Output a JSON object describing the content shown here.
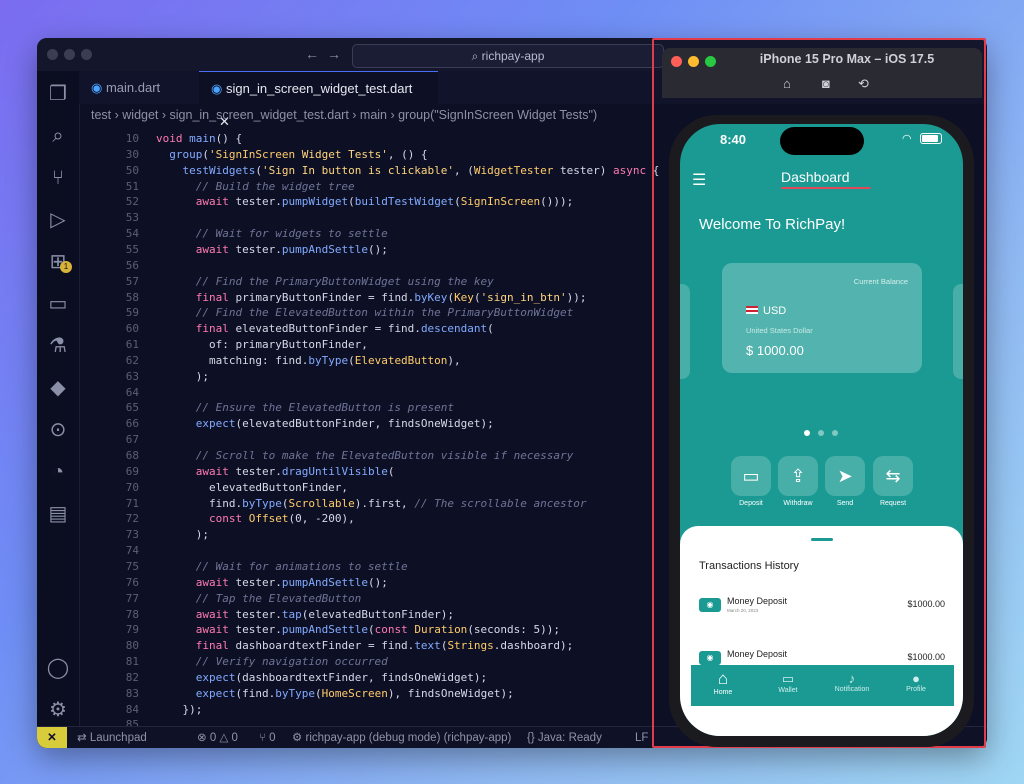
{
  "vscode": {
    "command_center": "richpay-app",
    "tabs": [
      {
        "label": "main.dart",
        "active": false
      },
      {
        "label": "sign_in_screen_widget_test.dart",
        "active": true,
        "close": "✕"
      }
    ],
    "breadcrumb": [
      "test",
      "widget",
      "sign_in_screen_widget_test.dart",
      "main",
      "group(\"SignInScreen Widget Tests\")"
    ],
    "sticky_lines": [
      {
        "n": "10",
        "code": "void main() {"
      },
      {
        "n": "30",
        "code": "  group('SignInScreen Widget Tests', () {"
      },
      {
        "n": "50",
        "code": "    testWidgets('Sign In button is clickable', (WidgetTester tester) async {"
      }
    ],
    "code_lines": [
      {
        "n": "51",
        "code": "      // Build the widget tree"
      },
      {
        "n": "52",
        "code": "      await tester.pumpWidget(buildTestWidget(SignInScreen()));"
      },
      {
        "n": "53",
        "code": ""
      },
      {
        "n": "54",
        "code": "      // Wait for widgets to settle"
      },
      {
        "n": "55",
        "code": "      await tester.pumpAndSettle();"
      },
      {
        "n": "56",
        "code": ""
      },
      {
        "n": "57",
        "code": "      // Find the PrimaryButtonWidget using the key"
      },
      {
        "n": "58",
        "code": "      final primaryButtonFinder = find.byKey(Key('sign_in_btn'));"
      },
      {
        "n": "59",
        "code": "      // Find the ElevatedButton within the PrimaryButtonWidget"
      },
      {
        "n": "60",
        "code": "      final elevatedButtonFinder = find.descendant("
      },
      {
        "n": "61",
        "code": "        of: primaryButtonFinder,"
      },
      {
        "n": "62",
        "code": "        matching: find.byType(ElevatedButton),"
      },
      {
        "n": "63",
        "code": "      );"
      },
      {
        "n": "64",
        "code": ""
      },
      {
        "n": "65",
        "code": "      // Ensure the ElevatedButton is present"
      },
      {
        "n": "66",
        "code": "      expect(elevatedButtonFinder, findsOneWidget);"
      },
      {
        "n": "67",
        "code": ""
      },
      {
        "n": "68",
        "code": "      // Scroll to make the ElevatedButton visible if necessary"
      },
      {
        "n": "69",
        "code": "      await tester.dragUntilVisible("
      },
      {
        "n": "70",
        "code": "        elevatedButtonFinder,"
      },
      {
        "n": "71",
        "code": "        find.byType(Scrollable).first, // The scrollable ancestor"
      },
      {
        "n": "72",
        "code": "        const Offset(0, -200),"
      },
      {
        "n": "73",
        "code": "      );"
      },
      {
        "n": "74",
        "code": ""
      },
      {
        "n": "75",
        "code": "      // Wait for animations to settle"
      },
      {
        "n": "76",
        "code": "      await tester.pumpAndSettle();"
      },
      {
        "n": "77",
        "code": "      // Tap the ElevatedButton"
      },
      {
        "n": "78",
        "code": "      await tester.tap(elevatedButtonFinder);"
      },
      {
        "n": "79",
        "code": "      await tester.pumpAndSettle(const Duration(seconds: 5));"
      },
      {
        "n": "80",
        "code": "      final dashboardtextFinder = find.text(Strings.dashboard);"
      },
      {
        "n": "81",
        "code": "      // Verify navigation occurred"
      },
      {
        "n": "82",
        "code": "      expect(dashboardtextFinder, findsOneWidget);"
      },
      {
        "n": "83",
        "code": "      expect(find.byType(HomeScreen), findsOneWidget);"
      },
      {
        "n": "84",
        "code": "    });"
      },
      {
        "n": "85",
        "code": ""
      }
    ],
    "status": {
      "remote": "✕",
      "launchpad": "Launchpad",
      "errors": "0",
      "warnings": "0",
      "ports": "0",
      "debug": "richpay-app (debug mode) (richpay-app)",
      "java": "Java: Ready",
      "eol": "LF"
    },
    "badge_count": "1"
  },
  "simulator": {
    "title": "iPhone 15 Pro Max – iOS 17.5"
  },
  "app": {
    "time": "8:40",
    "header": "Dashboard",
    "welcome": "Welcome To RichPay!",
    "card": {
      "balance_label": "Current Balance",
      "currency": "USD",
      "currency_name": "United States Dollar",
      "amount": "$ 1000.00"
    },
    "actions": [
      "Deposit",
      "Withdraw",
      "Send",
      "Request"
    ],
    "transactions_title": "Transactions History",
    "transactions": [
      {
        "title": "Money Deposit",
        "date": "March 20, 2023",
        "amount": "$1000.00"
      },
      {
        "title": "Money Deposit",
        "date": "",
        "amount": "$1000.00"
      }
    ],
    "nav": [
      "Home",
      "Wallet",
      "Notification",
      "Profile"
    ]
  },
  "colors": {
    "accent_teal": "#1a9a93",
    "highlight_red": "#e23b4a"
  }
}
